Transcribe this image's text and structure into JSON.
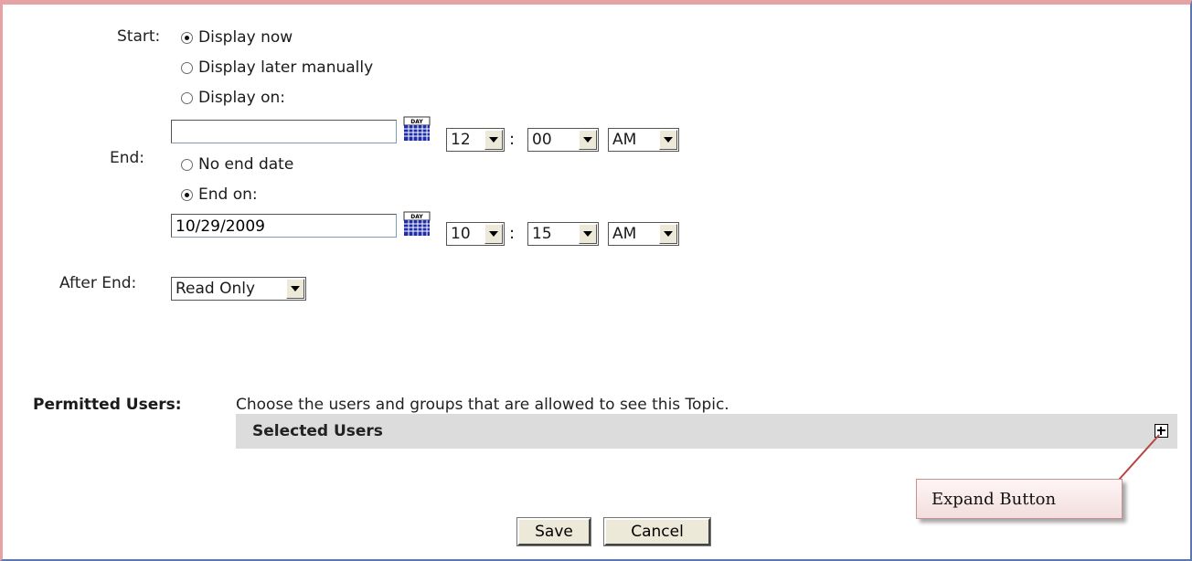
{
  "start": {
    "label": "Start:",
    "options": [
      "Display now",
      "Display later manually",
      "Display on:"
    ],
    "selected": 0,
    "date_value": "",
    "hour": "12",
    "minute": "00",
    "ampm": "AM"
  },
  "end": {
    "label": "End:",
    "options": [
      "No end date",
      "End on:"
    ],
    "selected": 1,
    "date_value": "10/29/2009",
    "hour": "10",
    "minute": "15",
    "ampm": "AM"
  },
  "time_separator": ":",
  "after_end": {
    "label": "After End:",
    "value": "Read Only"
  },
  "permitted_users": {
    "label": "Permitted Users:",
    "description": "Choose the users and groups that are allowed to see this Topic.",
    "panel_title": "Selected Users"
  },
  "buttons": {
    "save": "Save",
    "cancel": "Cancel"
  },
  "annotation": {
    "text": "Expand Button"
  },
  "icons": {
    "calendar": "calendar-icon",
    "expand": "plus-box-icon"
  },
  "colors": {
    "frame_top": "#e7a2a6",
    "frame_bottom": "#5a79b0",
    "panel_bg": "#dcdcdc"
  }
}
